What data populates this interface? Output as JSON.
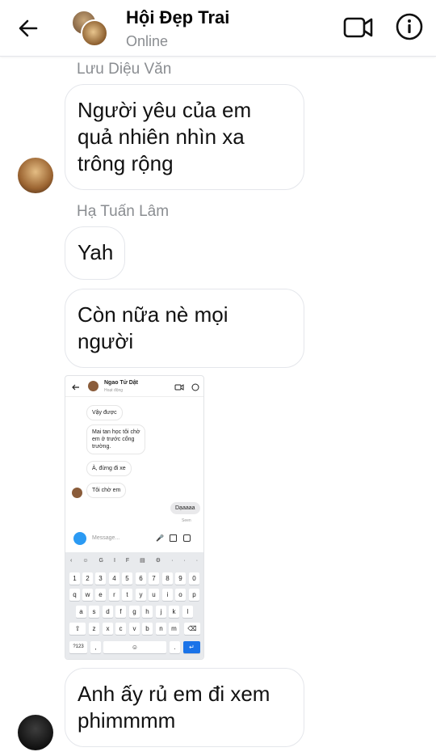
{
  "header": {
    "title": "Hội Đẹp Trai",
    "status": "Online"
  },
  "messages": [
    {
      "sender": "Lưu Diệu Văn",
      "text": "Người yêu của em\nquả nhiên nhìn xa\ntrông rộng"
    },
    {
      "sender": "Hạ Tuấn Lâm",
      "text": "Yah"
    },
    {
      "text": "Còn nữa nè mọi\nngười"
    },
    {
      "text": "Anh ấy rủ em đi xem\nphimmmm"
    }
  ],
  "screenshot": {
    "title": "Ngao Tử Dật",
    "subtitle": "Hoạt động",
    "messages_in": [
      "Vậy được",
      "Mai tan học tôi chờ\nem ở trước cổng\ntrường.",
      "À, đừng đi xe",
      "Tôi chờ em"
    ],
    "message_out": "Dạaaaa",
    "seen": "Seen",
    "input_placeholder": "Message...",
    "keyboard": {
      "toolbar": [
        "‹",
        "☺",
        "GIF",
        "▤",
        "⚙",
        "···",
        "🎤"
      ],
      "row_numbers": [
        "1",
        "2",
        "3",
        "4",
        "5",
        "6",
        "7",
        "8",
        "9",
        "0"
      ],
      "row1": [
        "q",
        "w",
        "e",
        "r",
        "t",
        "y",
        "u",
        "i",
        "o",
        "p"
      ],
      "row2": [
        "a",
        "s",
        "d",
        "f",
        "g",
        "h",
        "j",
        "k",
        "l"
      ],
      "row3": [
        "z",
        "x",
        "c",
        "v",
        "b",
        "n",
        "m"
      ],
      "sym_key": "?123",
      "comma_key": ","
    }
  }
}
